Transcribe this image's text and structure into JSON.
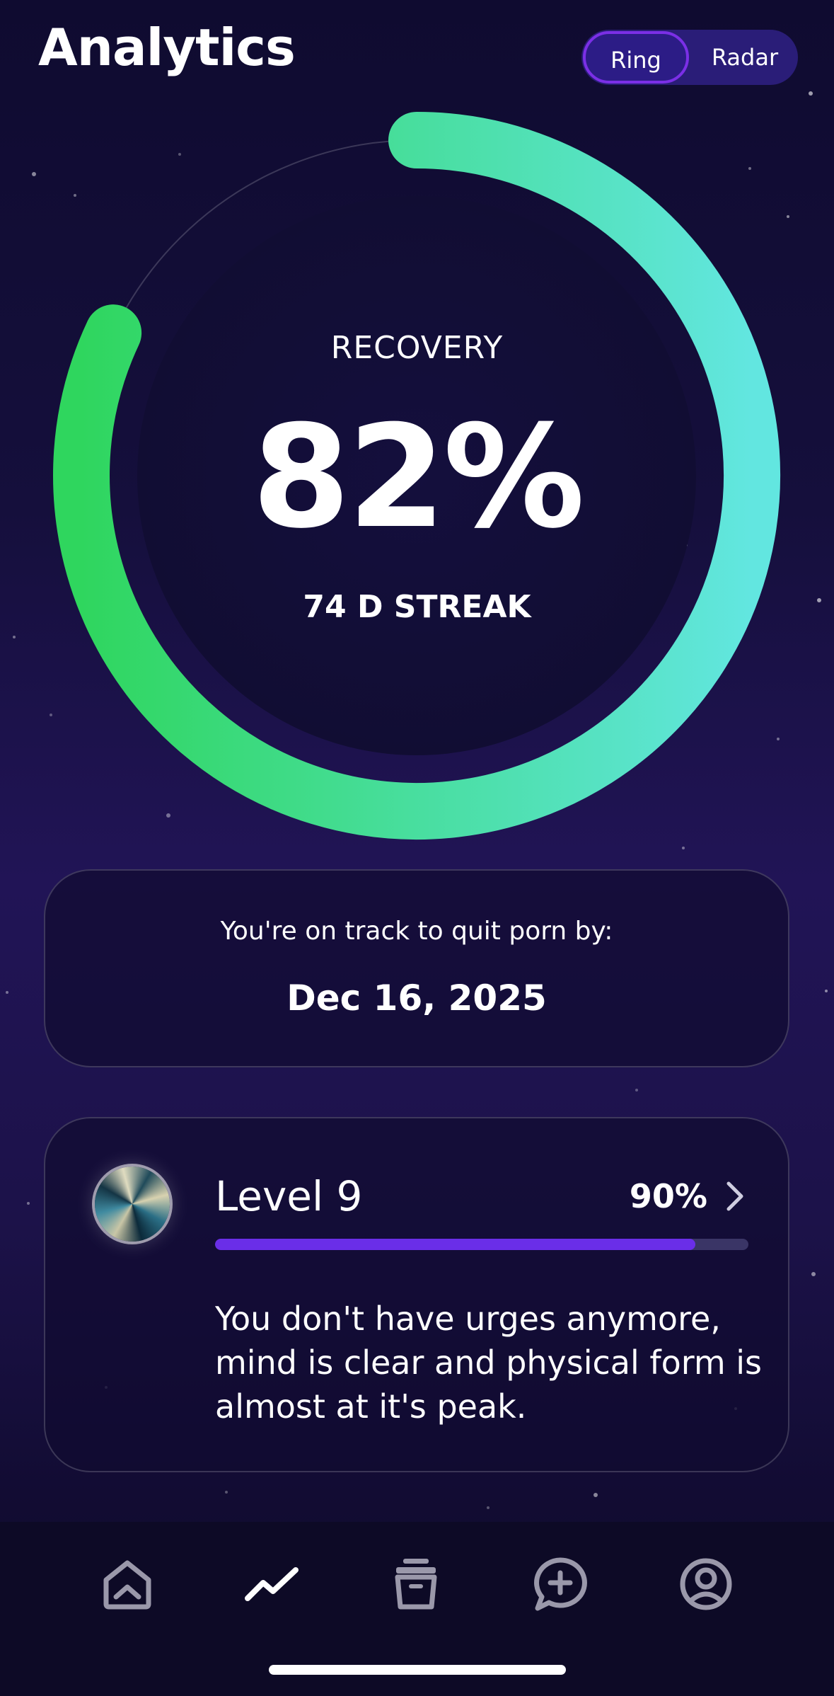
{
  "header": {
    "title": "Analytics",
    "view_toggle": {
      "options": [
        "Ring",
        "Radar"
      ],
      "selected": "Ring"
    }
  },
  "recovery": {
    "label": "RECOVERY",
    "value": "82%",
    "progress_fraction": 0.82,
    "streak": "74 D STREAK"
  },
  "track_card": {
    "text": "You're on track to quit porn by:",
    "date": "Dec 16, 2025"
  },
  "level_card": {
    "title": "Level 9",
    "percent": "90%",
    "progress_fraction": 0.9,
    "description": "You don't have urges anymore, mind is clear and physical form is almost at it's peak."
  },
  "tabbar": {
    "items": [
      {
        "icon": "home-icon",
        "selected": false
      },
      {
        "icon": "analytics-icon",
        "selected": true
      },
      {
        "icon": "archive-icon",
        "selected": false
      },
      {
        "icon": "chat-add-icon",
        "selected": false
      },
      {
        "icon": "profile-icon",
        "selected": false
      }
    ]
  },
  "colors": {
    "ring_start": "#2fd65e",
    "ring_end": "#62e6e0",
    "accent": "#6a2ee8",
    "toggle_border": "#7b2fe6"
  }
}
